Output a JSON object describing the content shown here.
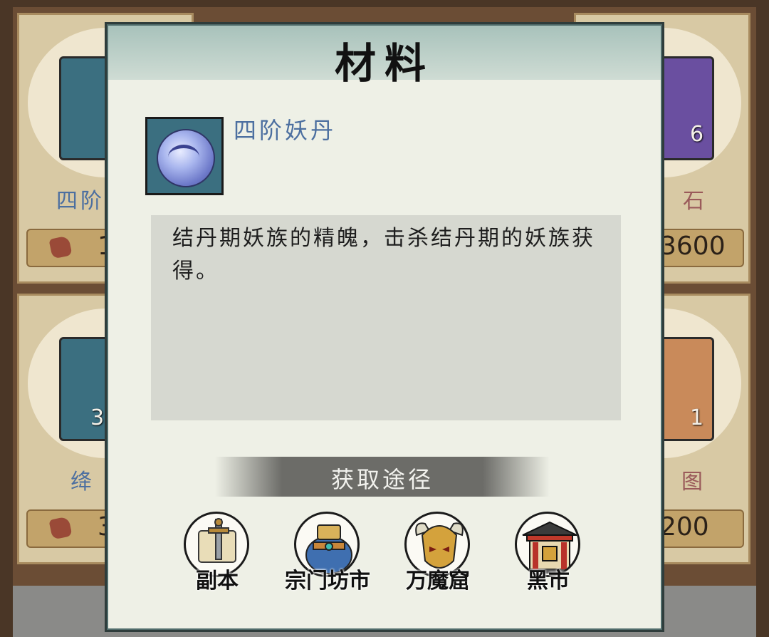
{
  "dialog": {
    "title": "材料",
    "item_name": "四阶妖丹",
    "description": "结丹期妖族的精魄，击杀结丹期的妖族获得。",
    "sources_title": "获取途径",
    "sources": [
      {
        "label": "副本",
        "icon": "scroll-sword-icon"
      },
      {
        "label": "宗门坊市",
        "icon": "merchant-bag-icon"
      },
      {
        "label": "万魔窟",
        "icon": "demon-mask-icon"
      },
      {
        "label": "黑市",
        "icon": "pavilion-icon"
      }
    ]
  },
  "background_cards": {
    "top_left": {
      "name": "四阶",
      "price": "1",
      "count": ""
    },
    "top_right": {
      "name": "石",
      "price": "3600",
      "count": "6"
    },
    "bottom_left": {
      "name": "绛",
      "price": "3",
      "count": "3"
    },
    "bottom_right": {
      "name": "图",
      "price": "200",
      "count": "1"
    }
  },
  "colors": {
    "item_name": "#4c6fa0",
    "header": "#a8c2bb",
    "accent_price_gem": "#9a4a38"
  }
}
